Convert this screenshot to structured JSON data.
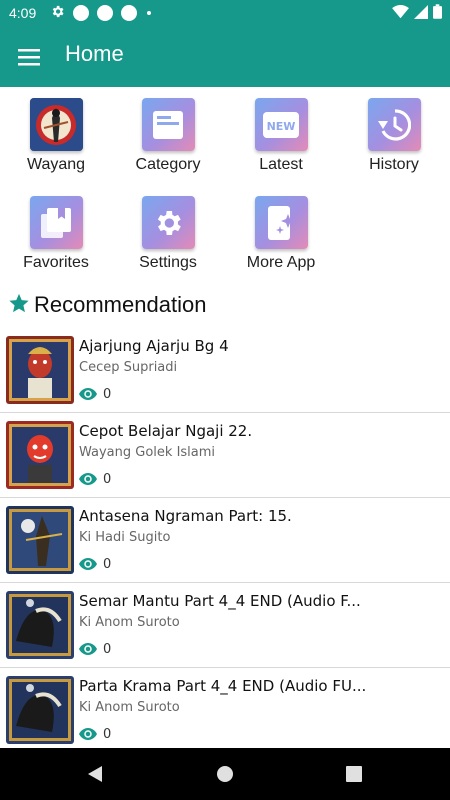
{
  "status_bar": {
    "time": "4:09",
    "left_icons": [
      "gear-icon",
      "circle-notification-icon",
      "circle-notification-icon",
      "circle-notification-icon",
      "small-dot-icon"
    ],
    "right_icons": [
      "wifi-icon",
      "signal-icon",
      "battery-icon"
    ]
  },
  "app_bar": {
    "title": "Home",
    "menu_icon": "hamburger-menu-icon",
    "color": "#16998a"
  },
  "menu_tiles": [
    {
      "label": "Wayang",
      "icon": "wayang-puppet-image"
    },
    {
      "label": "Category",
      "icon": "category-card-icon"
    },
    {
      "label": "Latest",
      "icon": "new-badge-icon"
    },
    {
      "label": "History",
      "icon": "history-clock-icon"
    },
    {
      "label": "Favorites",
      "icon": "favorites-bookmark-icon"
    },
    {
      "label": "Settings",
      "icon": "settings-gear-icon"
    },
    {
      "label": "More App",
      "icon": "more-app-sparkle-icon"
    }
  ],
  "recommendation": {
    "heading": "Recommendation",
    "icon": "star-icon",
    "items": [
      {
        "title": "Ajarjung Ajarju Bg 4",
        "author": "Cecep Supriadi",
        "views": "0",
        "thumb_color": "#8a2b1f"
      },
      {
        "title": "Cepot Belajar Ngaji 22.",
        "author": "Wayang Golek Islami",
        "views": "0",
        "thumb_color": "#9a2a22"
      },
      {
        "title": "Antasena Ngraman Part: 15.",
        "author": "Ki Hadi Sugito",
        "views": "0",
        "thumb_color": "#2f4a7a"
      },
      {
        "title": "Semar Mantu   Part 4_4 END (Audio F...",
        "author": "Ki Anom Suroto",
        "views": "0",
        "thumb_color": "#2a3f6e"
      },
      {
        "title": "Parta Krama   Part 4_4 END (Audio FU...",
        "author": "Ki Anom Suroto",
        "views": "0",
        "thumb_color": "#2a3f6e"
      }
    ]
  },
  "nav_bar": {
    "buttons": [
      "back-icon",
      "home-icon",
      "recents-icon"
    ]
  },
  "colors": {
    "accent": "#16998a",
    "icon_gradient": [
      "#7aa7ef",
      "#a58fe0",
      "#e48bb6"
    ]
  }
}
